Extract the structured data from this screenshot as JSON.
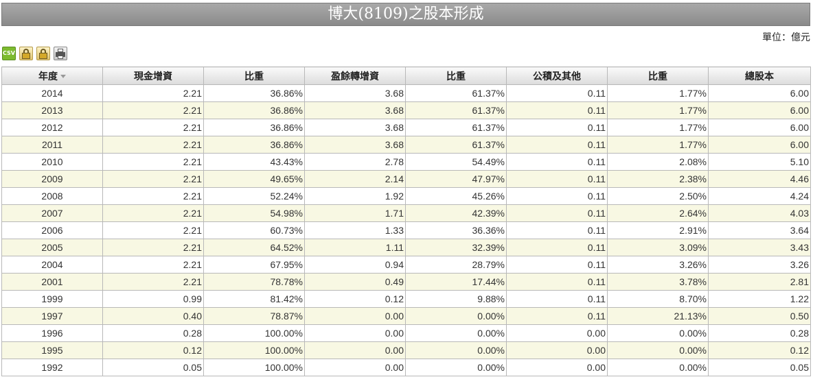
{
  "title": "博大(8109)之股本形成",
  "unit_label": "單位：億元",
  "toolbar": {
    "csv_label": "CSV",
    "icons": [
      "csv-icon",
      "lock-icon",
      "lock-icon",
      "printer-icon"
    ]
  },
  "table": {
    "headers": [
      "年度",
      "現金增資",
      "比重",
      "盈餘轉增資",
      "比重",
      "公積及其他",
      "比重",
      "總股本"
    ],
    "rows": [
      [
        "2014",
        "2.21",
        "36.86%",
        "3.68",
        "61.37%",
        "0.11",
        "1.77%",
        "6.00"
      ],
      [
        "2013",
        "2.21",
        "36.86%",
        "3.68",
        "61.37%",
        "0.11",
        "1.77%",
        "6.00"
      ],
      [
        "2012",
        "2.21",
        "36.86%",
        "3.68",
        "61.37%",
        "0.11",
        "1.77%",
        "6.00"
      ],
      [
        "2011",
        "2.21",
        "36.86%",
        "3.68",
        "61.37%",
        "0.11",
        "1.77%",
        "6.00"
      ],
      [
        "2010",
        "2.21",
        "43.43%",
        "2.78",
        "54.49%",
        "0.11",
        "2.08%",
        "5.10"
      ],
      [
        "2009",
        "2.21",
        "49.65%",
        "2.14",
        "47.97%",
        "0.11",
        "2.38%",
        "4.46"
      ],
      [
        "2008",
        "2.21",
        "52.24%",
        "1.92",
        "45.26%",
        "0.11",
        "2.50%",
        "4.24"
      ],
      [
        "2007",
        "2.21",
        "54.98%",
        "1.71",
        "42.39%",
        "0.11",
        "2.64%",
        "4.03"
      ],
      [
        "2006",
        "2.21",
        "60.73%",
        "1.33",
        "36.36%",
        "0.11",
        "2.91%",
        "3.64"
      ],
      [
        "2005",
        "2.21",
        "64.52%",
        "1.11",
        "32.39%",
        "0.11",
        "3.09%",
        "3.43"
      ],
      [
        "2004",
        "2.21",
        "67.95%",
        "0.94",
        "28.79%",
        "0.11",
        "3.26%",
        "3.26"
      ],
      [
        "2001",
        "2.21",
        "78.78%",
        "0.49",
        "17.44%",
        "0.11",
        "3.78%",
        "2.81"
      ],
      [
        "1999",
        "0.99",
        "81.42%",
        "0.12",
        "9.88%",
        "0.11",
        "8.70%",
        "1.22"
      ],
      [
        "1997",
        "0.40",
        "78.87%",
        "0.00",
        "0.00%",
        "0.11",
        "21.13%",
        "0.50"
      ],
      [
        "1996",
        "0.28",
        "100.00%",
        "0.00",
        "0.00%",
        "0.00",
        "0.00%",
        "0.28"
      ],
      [
        "1995",
        "0.12",
        "100.00%",
        "0.00",
        "0.00%",
        "0.00",
        "0.00%",
        "0.12"
      ],
      [
        "1992",
        "0.05",
        "100.00%",
        "0.00",
        "0.00%",
        "0.00",
        "0.00%",
        "0.05"
      ]
    ]
  }
}
